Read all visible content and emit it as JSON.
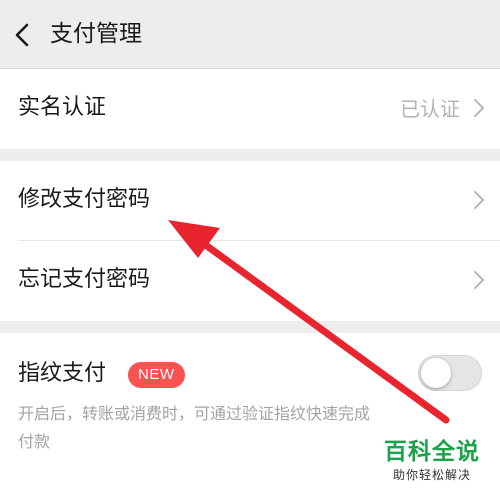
{
  "header": {
    "title": "支付管理",
    "back_icon": "chevron-left-icon"
  },
  "groups": [
    {
      "items": [
        {
          "label": "实名认证",
          "value": "已认证"
        }
      ]
    },
    {
      "items": [
        {
          "label": "修改支付密码"
        },
        {
          "label": "忘记支付密码"
        }
      ]
    },
    {
      "fingerprint": {
        "label": "指纹支付",
        "badge": "NEW",
        "toggle_on": false,
        "description": "开启后，转账或消费时，可通过验证指纹快速完成付款"
      }
    }
  ],
  "watermark": {
    "main": "百科全说",
    "sub": "助你轻松解决"
  },
  "colors": {
    "badge": "#fa5151",
    "arrow": "#e8252e",
    "watermark": "#1aa34a",
    "background": "#ededed"
  }
}
